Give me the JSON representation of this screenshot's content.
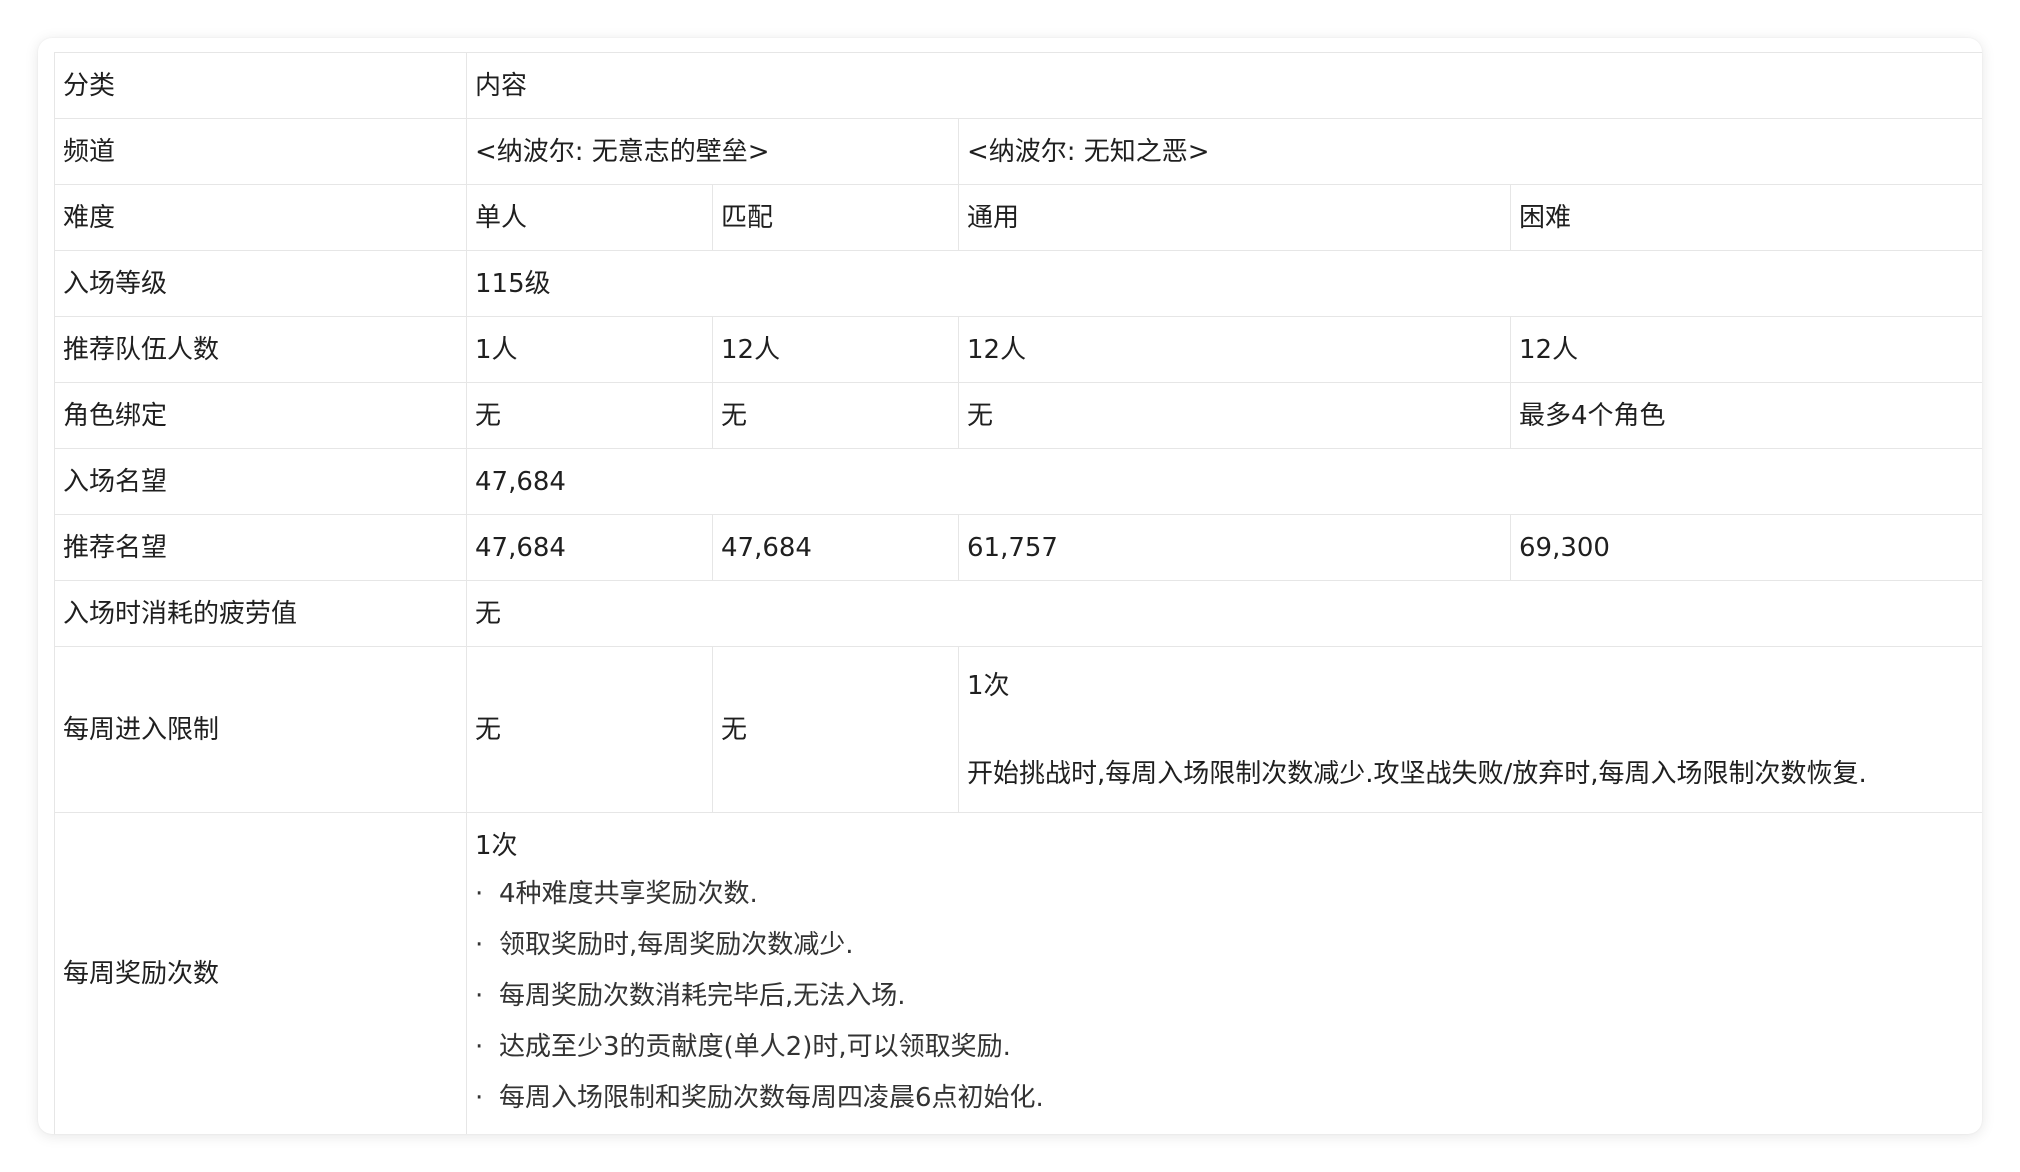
{
  "table": {
    "row_category": {
      "label": "分类",
      "value": "内容"
    },
    "row_channel": {
      "label": "频道",
      "channel_1": "<纳波尔: 无意志的壁垒>",
      "channel_2": "<纳波尔: 无知之恶>"
    },
    "row_difficulty": {
      "label": "难度",
      "values": [
        "单人",
        "匹配",
        "通用",
        "困难"
      ]
    },
    "row_entry_level": {
      "label": "入场等级",
      "value": "115级"
    },
    "row_party_size": {
      "label": "推荐队伍人数",
      "values": [
        "1人",
        "12人",
        "12人",
        "12人"
      ]
    },
    "row_character_bind": {
      "label": "角色绑定",
      "values": [
        "无",
        "无",
        "无",
        "最多4个角色"
      ]
    },
    "row_entry_fame": {
      "label": "入场名望",
      "value": "47,684"
    },
    "row_recommended_fame": {
      "label": "推荐名望",
      "values": [
        "47,684",
        "47,684",
        "61,757",
        "69,300"
      ]
    },
    "row_fatigue": {
      "label": "入场时消耗的疲劳值",
      "value": "无"
    },
    "row_weekly_limit": {
      "label": "每周进入限制",
      "solo": "无",
      "match": "无",
      "count": "1次",
      "note": "开始挑战时,每周入场限制次数减少.攻坚战失败/放弃时,每周入场限制次数恢复."
    },
    "row_weekly_reward": {
      "label": "每周奖励次数",
      "count": "1次",
      "bullet": "·",
      "notes": [
        "4种难度共享奖励次数.",
        "领取奖励时,每周奖励次数减少.",
        "每周奖励次数消耗完毕后,无法入场.",
        "达成至少3的贡献度(单人2)时,可以领取奖励.",
        "每周入场限制和奖励次数每周四凌晨6点初始化."
      ]
    }
  }
}
